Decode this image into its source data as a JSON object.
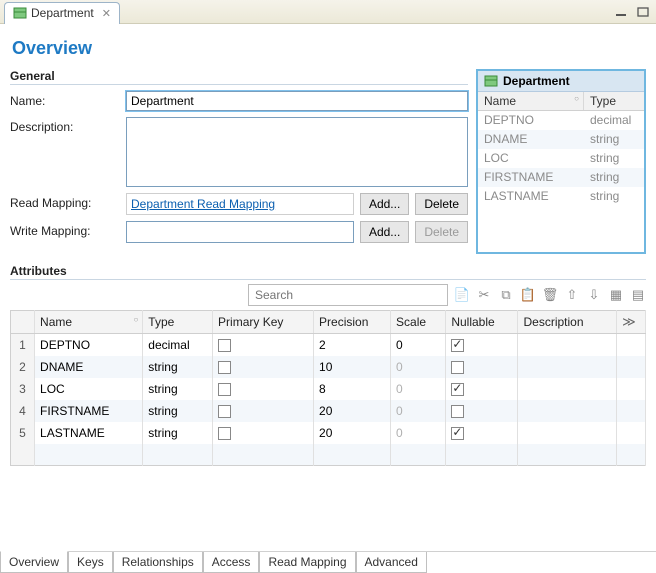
{
  "titlebar": {
    "tab_label": "Department"
  },
  "page": {
    "title": "Overview"
  },
  "general": {
    "heading": "General",
    "name_label": "Name:",
    "name_value": "Department",
    "desc_label": "Description:",
    "desc_value": "",
    "read_mapping_label": "Read Mapping:",
    "read_mapping_link": "Department Read Mapping",
    "write_mapping_label": "Write Mapping:",
    "write_mapping_value": "",
    "add_label": "Add...",
    "delete_label": "Delete"
  },
  "entity_preview": {
    "title": "Department",
    "col_name": "Name",
    "col_type": "Type",
    "rows": [
      {
        "name": "DEPTNO",
        "type": "decimal"
      },
      {
        "name": "DNAME",
        "type": "string"
      },
      {
        "name": "LOC",
        "type": "string"
      },
      {
        "name": "FIRSTNAME",
        "type": "string"
      },
      {
        "name": "LASTNAME",
        "type": "string"
      }
    ]
  },
  "attrs": {
    "heading": "Attributes",
    "search_placeholder": "Search",
    "cols": {
      "name": "Name",
      "type": "Type",
      "pk": "Primary Key",
      "precision": "Precision",
      "scale": "Scale",
      "nullable": "Nullable",
      "desc": "Description"
    },
    "rows": [
      {
        "n": "1",
        "name": "DEPTNO",
        "type": "decimal",
        "pk": false,
        "precision": "2",
        "scale": "0",
        "scale_grey": false,
        "nullable": true,
        "desc": ""
      },
      {
        "n": "2",
        "name": "DNAME",
        "type": "string",
        "pk": false,
        "precision": "10",
        "scale": "0",
        "scale_grey": true,
        "nullable": false,
        "desc": ""
      },
      {
        "n": "3",
        "name": "LOC",
        "type": "string",
        "pk": false,
        "precision": "8",
        "scale": "0",
        "scale_grey": true,
        "nullable": true,
        "desc": ""
      },
      {
        "n": "4",
        "name": "FIRSTNAME",
        "type": "string",
        "pk": false,
        "precision": "20",
        "scale": "0",
        "scale_grey": true,
        "nullable": false,
        "desc": ""
      },
      {
        "n": "5",
        "name": "LASTNAME",
        "type": "string",
        "pk": false,
        "precision": "20",
        "scale": "0",
        "scale_grey": true,
        "nullable": true,
        "desc": ""
      }
    ]
  },
  "bottom_tabs": {
    "overview": "Overview",
    "keys": "Keys",
    "relationships": "Relationships",
    "access": "Access",
    "read_mapping": "Read Mapping",
    "advanced": "Advanced"
  }
}
